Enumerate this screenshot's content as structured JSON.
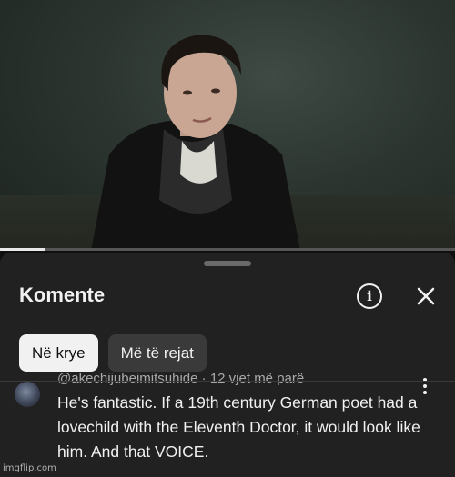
{
  "video": {
    "progress_fraction": 0.1,
    "thumbnail": "man in dark coat and scarf"
  },
  "comments_sheet": {
    "title": "Komente",
    "info_icon": "info-circle-icon",
    "close_icon": "close-icon",
    "chips": [
      {
        "label": "Në krye",
        "selected": true
      },
      {
        "label": "Më të rejat",
        "selected": false
      }
    ],
    "comment": {
      "author": "@akechijubeimitsuhide",
      "time_ago": "12 vjet më parë",
      "separator": " · ",
      "text": "He's fantastic. If a 19th century German poet had a lovechild with the Eleventh Doctor, it would look like him. And that VOICE."
    }
  },
  "watermark": "imgflip.com",
  "colors": {
    "background": "#0f0f0f",
    "sheet": "#212121",
    "chip_selected": "#f1f1f1",
    "chip_unselected": "#3a3a3a",
    "meta_text": "#aaaaaa"
  }
}
